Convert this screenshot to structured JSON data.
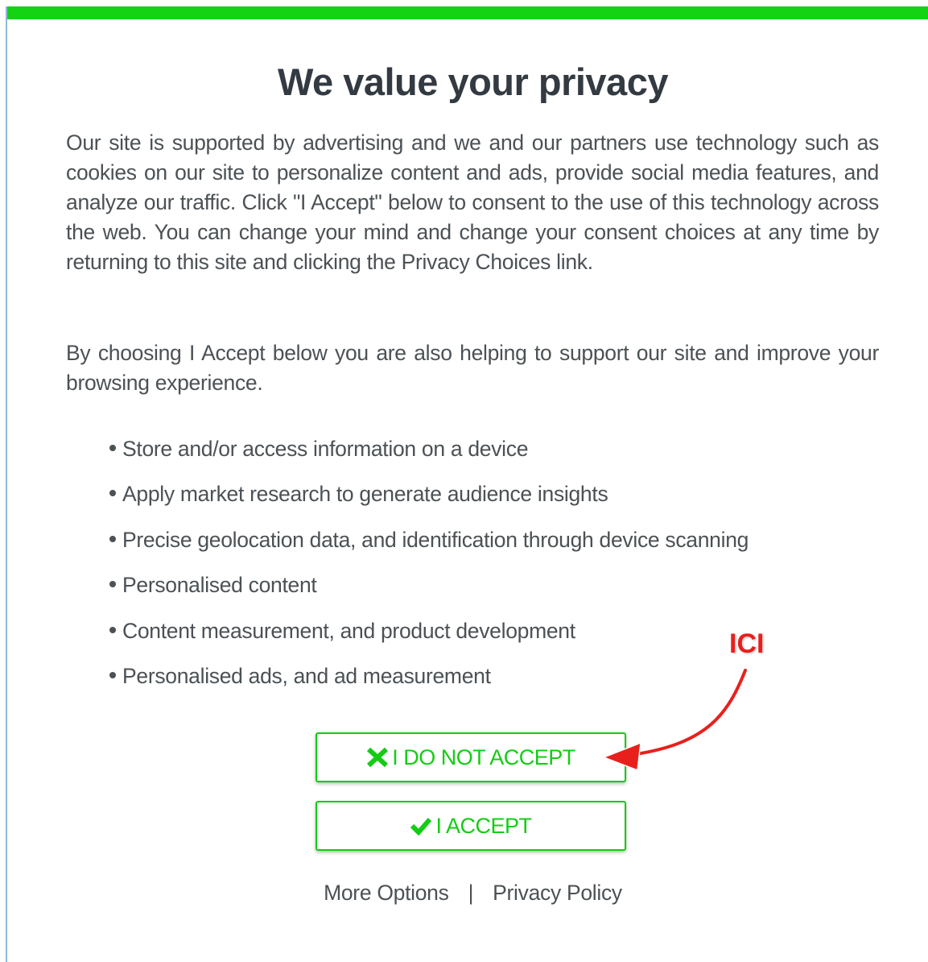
{
  "dialog": {
    "title": "We value your privacy",
    "paragraph_1": "Our site is supported by advertising and we and our partners use technology such as cookies on our site to personalize content and ads, provide social media features, and analyze our traffic. Click \"I Accept\" below to consent to the use of this technology across the web. You can change your mind and change your consent choices at any time by returning to this site and clicking the Privacy Choices link.",
    "paragraph_2": "By choosing I Accept below you are also helping to support our site and improve your browsing experience.",
    "purposes": [
      "Store and/or access information on a device",
      "Apply market research to generate audience insights",
      "Precise geolocation data, and identification through device scanning",
      "Personalised content",
      "Content measurement, and product development",
      "Personalised ads, and ad measurement"
    ],
    "reject_button": {
      "label": "I DO NOT ACCEPT",
      "icon": "x-icon"
    },
    "accept_button": {
      "label": "I ACCEPT",
      "icon": "checkmark-icon"
    },
    "footer": {
      "more_options": "More Options",
      "separator": "|",
      "privacy_policy": "Privacy Policy"
    }
  },
  "annotation": {
    "label": "ICI",
    "color": "#e8201c",
    "icon": "red-curved-arrow"
  },
  "colors": {
    "accent": "#13d313",
    "button_text": "#14cc14",
    "text": "#4b5155",
    "title": "#333a42"
  }
}
